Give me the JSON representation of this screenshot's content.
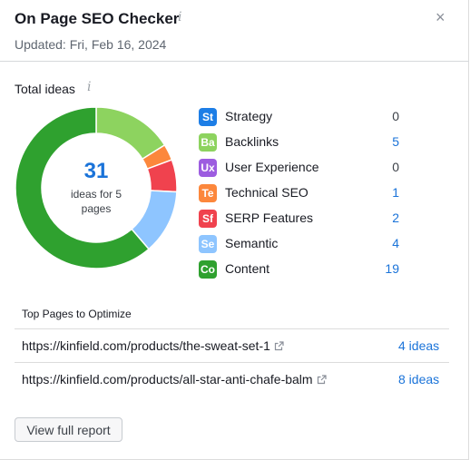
{
  "widget": {
    "title": "On Page SEO Checker",
    "info_icon": "i",
    "close_icon": "×",
    "updated": "Updated: Fri, Feb 16, 2024"
  },
  "summary": {
    "label": "Total ideas",
    "info_icon": "i",
    "total": "31",
    "caption": "ideas for 5 pages"
  },
  "chart_data": {
    "type": "pie",
    "donut": true,
    "start_angle_deg": 0,
    "direction": "clockwise",
    "categories": [
      "Strategy",
      "Backlinks",
      "User Experience",
      "Technical SEO",
      "SERP Features",
      "Semantic",
      "Content"
    ],
    "values": [
      0,
      5,
      0,
      1,
      2,
      4,
      19
    ],
    "colors": [
      "#1d7ee6",
      "#8dd35f",
      "#9d5de0",
      "#fc873c",
      "#f0424e",
      "#8ec5ff",
      "#2fa12f"
    ]
  },
  "legend": [
    {
      "abbr": "St",
      "label": "Strategy",
      "count": "0",
      "color": "#1d7ee6"
    },
    {
      "abbr": "Ba",
      "label": "Backlinks",
      "count": "5",
      "color": "#8dd35f"
    },
    {
      "abbr": "Ux",
      "label": "User Experience",
      "count": "0",
      "color": "#9d5de0"
    },
    {
      "abbr": "Te",
      "label": "Technical SEO",
      "count": "1",
      "color": "#fc873c"
    },
    {
      "abbr": "Sf",
      "label": "SERP Features",
      "count": "2",
      "color": "#f0424e"
    },
    {
      "abbr": "Se",
      "label": "Semantic",
      "count": "4",
      "color": "#8ec5ff"
    },
    {
      "abbr": "Co",
      "label": "Content",
      "count": "19",
      "color": "#2fa12f"
    }
  ],
  "top_pages": {
    "title": "Top Pages to Optimize",
    "rows": [
      {
        "url": "https://kinfield.com/products/the-sweat-set-1",
        "ideas": "4 ideas",
        "ext_icon": "external-link-icon"
      },
      {
        "url": "https://kinfield.com/products/all-star-anti-chafe-balm",
        "ideas": "8 ideas",
        "ext_icon": "external-link-icon"
      }
    ]
  },
  "footer": {
    "button_label": "View full report"
  }
}
